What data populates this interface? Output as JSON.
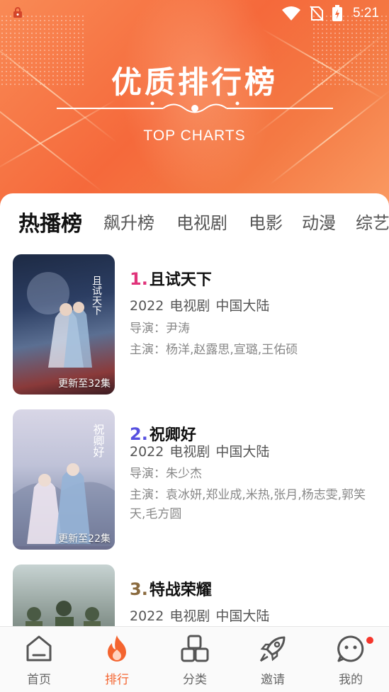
{
  "status_bar": {
    "time": "5:21"
  },
  "header": {
    "title": "优质排行榜",
    "subtitle": "TOP CHARTS"
  },
  "tabs": [
    {
      "label": "热播榜",
      "active": true
    },
    {
      "label": "飙升榜"
    },
    {
      "label": "电视剧"
    },
    {
      "label": "电影"
    },
    {
      "label": "动漫"
    },
    {
      "label": "综艺"
    }
  ],
  "list": [
    {
      "rank": "1.",
      "rank_color": "#e0337a",
      "title": "且试天下",
      "year": "2022",
      "type": "电视剧",
      "region": "中国大陆",
      "director": "导演：尹涛",
      "cast": "主演：杨洋,赵露思,宣璐,王佑硕",
      "update": "更新至32集"
    },
    {
      "rank": "2.",
      "rank_color": "#5650e0",
      "title": "祝卿好",
      "year": "2022",
      "type": "电视剧",
      "region": "中国大陆",
      "director": "导演：朱少杰",
      "cast": "主演：袁冰妍,郑业成,米热,张月,杨志雯,郭笑天,毛方圆",
      "update": "更新至22集"
    },
    {
      "rank": "3.",
      "rank_color": "#8a6a3e",
      "title": "特战荣耀",
      "year": "2022",
      "type": "电视剧",
      "region": "中国大陆"
    }
  ],
  "bottom_nav": [
    {
      "label": "首页",
      "icon": "home-icon"
    },
    {
      "label": "排行",
      "icon": "flame-icon",
      "active": true
    },
    {
      "label": "分类",
      "icon": "category-icon"
    },
    {
      "label": "邀请",
      "icon": "rocket-icon"
    },
    {
      "label": "我的",
      "icon": "profile-icon"
    }
  ],
  "colors": {
    "accent": "#f4642f",
    "hero": "#f5693b"
  }
}
